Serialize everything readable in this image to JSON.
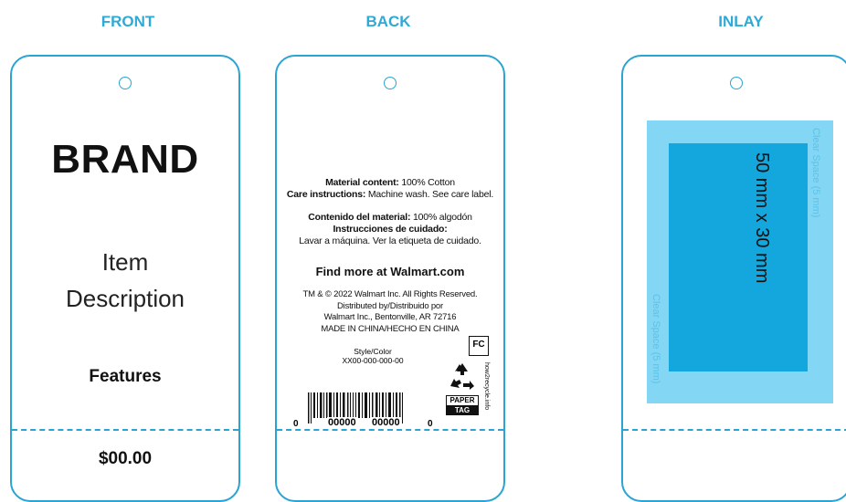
{
  "headings": {
    "front": "FRONT",
    "back": "BACK",
    "inlay": "INLAY"
  },
  "front": {
    "brand": "BRAND",
    "item_line1": "Item",
    "item_line2": "Description",
    "features": "Features",
    "price": "$00.00"
  },
  "back": {
    "material_label": "Material content:",
    "material_value": "100% Cotton",
    "care_label": "Care instructions:",
    "care_value": "Machine wash. See care label.",
    "contenido_label": "Contenido del material:",
    "contenido_value": "100% algodón",
    "instrucciones_label": "Instrucciones de cuidado:",
    "instrucciones_value": "Lavar a máquina. Ver la etiqueta de cuidado.",
    "find_more": "Find more at Walmart.com",
    "copyright": "TM & © 2022 Walmart Inc. All Rights Reserved.",
    "distributed": "Distributed by/Distribuido por",
    "address": "Walmart Inc., Bentonville, AR 72716",
    "made_in": "MADE IN CHINA/HECHO EN CHINA",
    "style_label": "Style/Color",
    "style_code": "XX00-000-000-00",
    "barcode_left": "0",
    "barcode_mid1": "00000",
    "barcode_mid2": "00000",
    "barcode_right": "0",
    "recycle_url": "how2recycle.info",
    "paper_label": "PAPER",
    "tag_label": "TAG"
  },
  "inlay": {
    "size": "50 mm x 30 mm",
    "clear_space_right": "Clear Space (5 mm)",
    "clear_space_left": "Clear Space (5 mm)"
  },
  "colors": {
    "heading": "#2fa9d6",
    "outline": "#2aa4d2",
    "clear_space": "#83d6f4",
    "inlay_area": "#13a7dd"
  }
}
